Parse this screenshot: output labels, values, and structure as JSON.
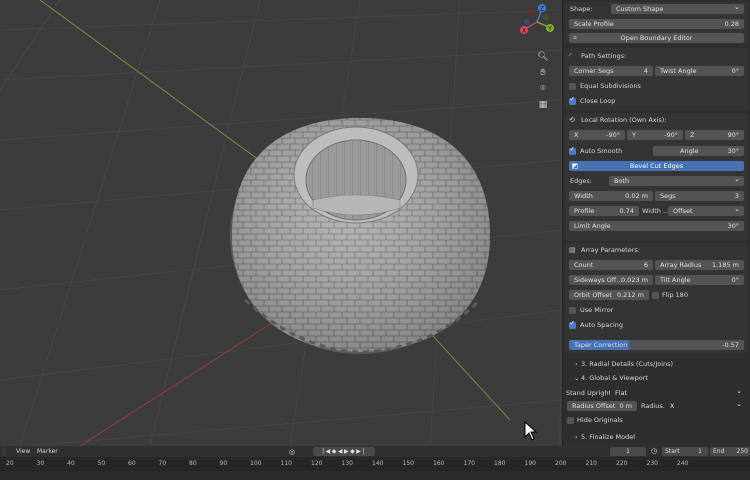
{
  "panel": {
    "shape": {
      "label": "Shape:",
      "value": "Custom Shape"
    },
    "scale_profile": {
      "label": "Scale Profile",
      "value": "0.28"
    },
    "open_boundary_editor": "Open Boundary Editor",
    "path_settings": "Path Settings:",
    "corner_segs": {
      "label": "Corner Segs",
      "value": "4"
    },
    "twist_angle": {
      "label": "Twist Angle",
      "value": "0°"
    },
    "equal_subdivisions": {
      "label": "Equal Subdivisions",
      "checked": false
    },
    "close_loop": {
      "label": "Close Loop",
      "checked": true
    },
    "local_rotation": "Local Rotation (Own Axis):",
    "rot_x": {
      "label": "X",
      "value": "-90°"
    },
    "rot_y": {
      "label": "Y",
      "value": "-90°"
    },
    "rot_z": {
      "label": "Z",
      "value": "90°"
    },
    "auto_smooth": {
      "label": "Auto Smooth",
      "checked": true
    },
    "angle": {
      "label": "Angle",
      "value": "30°"
    },
    "bevel_cut_edges": "Bevel Cut Edges",
    "edges": {
      "label": "Edges:",
      "value": "Both"
    },
    "width": {
      "label": "Width",
      "value": "0.02 m"
    },
    "segs": {
      "label": "Segs",
      "value": "3"
    },
    "profile": {
      "label": "Profile",
      "value": "0.74"
    },
    "width_type": {
      "label": "Width ...",
      "value": "Offset"
    },
    "limit_angle": {
      "label": "Limit Angle",
      "value": "30°"
    },
    "array_parameters": "Array Parameters:",
    "count": {
      "label": "Count",
      "value": "6"
    },
    "array_radius": {
      "label": "Array Radius",
      "value": "1.185 m"
    },
    "sideways_off": {
      "label": "Sideways Off...",
      "value": "0.023 m"
    },
    "tilt_angle": {
      "label": "Tilt Angle",
      "value": "0°"
    },
    "orbit_offset": {
      "label": "Orbit Offset",
      "value": "0.212 m"
    },
    "flip_180": {
      "label": "Flip 180",
      "checked": false
    },
    "use_mirror": {
      "label": "Use Mirror",
      "checked": false
    },
    "auto_spacing": {
      "label": "Auto Spacing",
      "checked": true
    },
    "taper_correction": {
      "label": "Taper Correction",
      "value": "-0.57",
      "fill": 0.34
    },
    "sec3": "3. Radial Details (Cuts/Joins)",
    "sec4": "4. Global & Viewport",
    "stand_upright": {
      "label": "Stand Upright:",
      "value": "Flat"
    },
    "radius_offset": {
      "label": "Radius Offset",
      "value": "0 m"
    },
    "radius_axis": {
      "label": "Radius...",
      "value": "X"
    },
    "hide_originals": {
      "label": "Hide Originals",
      "checked": false
    },
    "sec5": "5. Finalize Model"
  },
  "gizmo": {
    "z": "Z",
    "y": "Y",
    "x": "X",
    "colors": {
      "x": "#e0475a",
      "y": "#7fb22a",
      "z": "#3f7ee0"
    }
  },
  "timeline": {
    "view": "View",
    "marker": "Marker",
    "current_frame": "1",
    "start_label": "Start",
    "start": "1",
    "end_label": "End",
    "end": "250",
    "ticks": [
      "20",
      "30",
      "40",
      "50",
      "60",
      "70",
      "80",
      "90",
      "100",
      "110",
      "120",
      "130",
      "140",
      "150",
      "160",
      "170",
      "180",
      "190",
      "200",
      "210",
      "220",
      "230",
      "240"
    ]
  }
}
